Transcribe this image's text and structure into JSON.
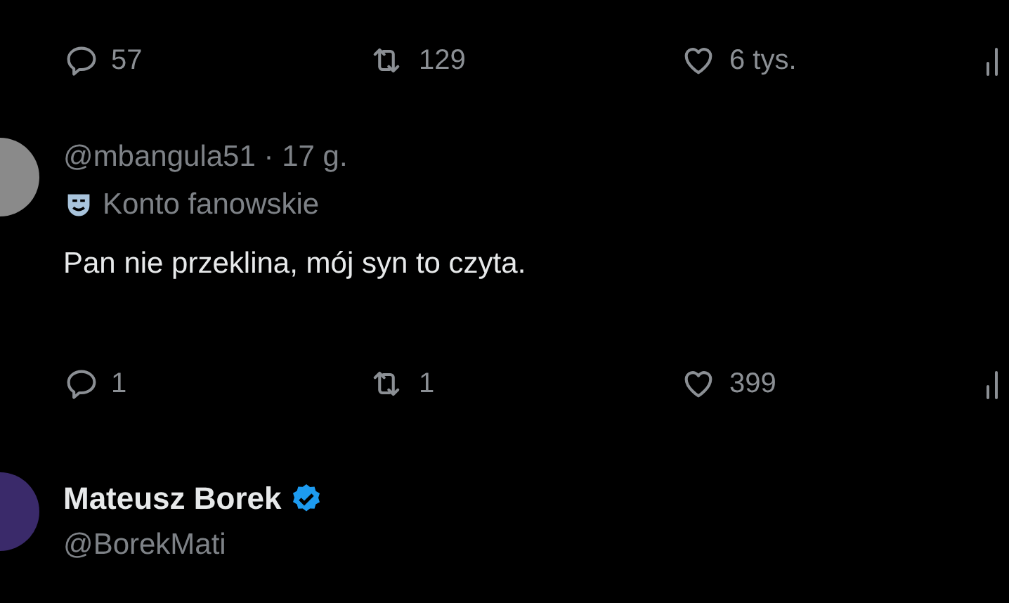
{
  "posts": [
    {
      "kind": "actions_only",
      "actions": [
        {
          "kind": "reply",
          "count": "57"
        },
        {
          "kind": "repost",
          "count": "129"
        },
        {
          "kind": "like",
          "count": "6 tys."
        },
        {
          "kind": "views"
        }
      ]
    },
    {
      "kind": "reply",
      "handle": "@mbangula51",
      "separator": "·",
      "time": "17 g.",
      "badge": "Konto fanowskie",
      "text": "Pan nie przeklina, mój syn to czyta.",
      "actions": [
        {
          "kind": "reply",
          "count": "1"
        },
        {
          "kind": "repost",
          "count": "1"
        },
        {
          "kind": "like",
          "count": "399"
        },
        {
          "kind": "views"
        }
      ]
    },
    {
      "kind": "header",
      "name": "Mateusz Borek",
      "verified": true,
      "handle": "@BorekMati"
    }
  ]
}
